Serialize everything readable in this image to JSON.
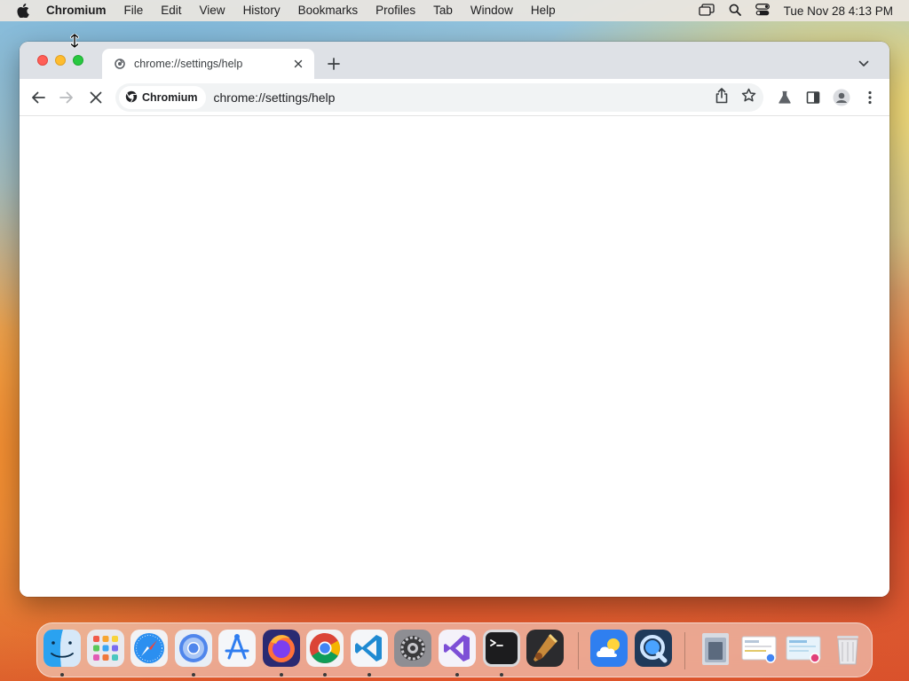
{
  "menubar": {
    "app_name": "Chromium",
    "items": [
      "File",
      "Edit",
      "View",
      "History",
      "Bookmarks",
      "Profiles",
      "Tab",
      "Window",
      "Help"
    ],
    "clock": "Tue Nov 28  4:13 PM",
    "status_icons": [
      "screen-mirroring-icon",
      "spotlight-search-icon",
      "control-center-icon"
    ]
  },
  "browser": {
    "tab": {
      "title": "chrome://settings/help"
    },
    "omnibox": {
      "chip_label": "Chromium",
      "url": "chrome://settings/help"
    },
    "page_state": "loading"
  },
  "dock": {
    "apps": [
      {
        "name": "finder",
        "running": true
      },
      {
        "name": "launchpad",
        "running": false
      },
      {
        "name": "safari",
        "running": false
      },
      {
        "name": "chromium",
        "running": true
      },
      {
        "name": "xcode-instruments",
        "running": false
      },
      {
        "name": "firefox",
        "running": true
      },
      {
        "name": "google-chrome",
        "running": true
      },
      {
        "name": "visual-studio-code",
        "running": true
      },
      {
        "name": "system-settings",
        "running": false
      },
      {
        "name": "visual-studio",
        "running": true
      },
      {
        "name": "terminal",
        "running": true
      },
      {
        "name": "instruments",
        "running": false
      },
      {
        "name": "weather",
        "running": false
      },
      {
        "name": "quicktime-player",
        "running": false
      },
      {
        "name": "downloads-stack",
        "running": false
      },
      {
        "name": "document-stack-1",
        "running": false
      },
      {
        "name": "document-stack-2",
        "running": false
      },
      {
        "name": "trash",
        "running": false
      }
    ]
  },
  "colors": {
    "tabstrip": "#dee1e6",
    "omnibox": "#f1f3f4",
    "traffic_red": "#ff5f57",
    "traffic_yellow": "#febc2e",
    "traffic_green": "#28c840"
  }
}
